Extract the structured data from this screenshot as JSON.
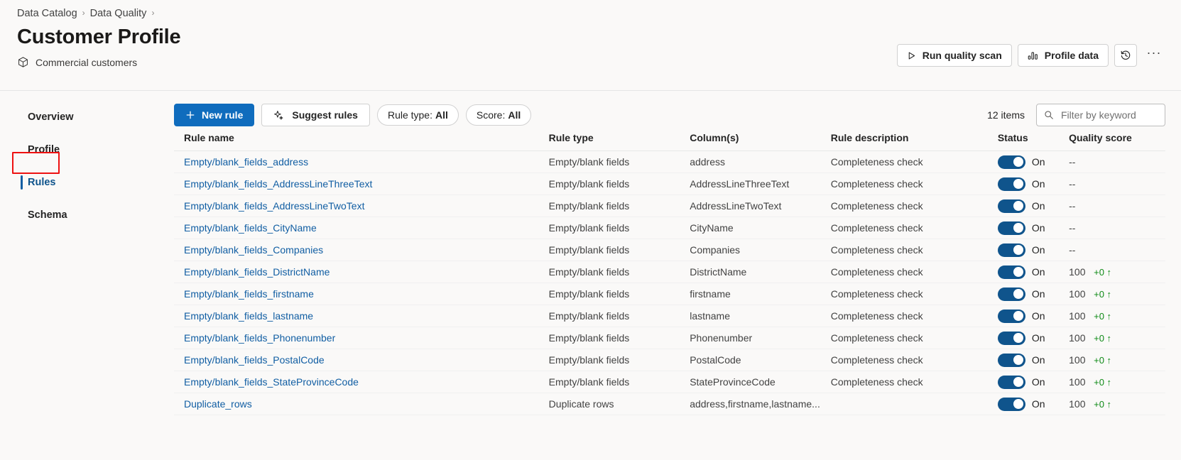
{
  "breadcrumb": {
    "items": [
      "Data Catalog",
      "Data Quality"
    ],
    "separator": "›"
  },
  "header": {
    "title": "Customer Profile",
    "subtitle": "Commercial customers",
    "subtitle_icon": "package-icon",
    "actions": [
      {
        "label": "Run quality scan",
        "icon": "play-icon"
      },
      {
        "label": "Profile data",
        "icon": "bar-chart-icon"
      },
      {
        "label": "",
        "icon": "history-icon"
      },
      {
        "label": "···",
        "icon": "more-options-icon"
      }
    ]
  },
  "sidebar": {
    "items": [
      {
        "label": "Overview",
        "selected": false
      },
      {
        "label": "Profile",
        "selected": false
      },
      {
        "label": "Rules",
        "selected": true
      },
      {
        "label": "Schema",
        "selected": false
      }
    ]
  },
  "toolbar": {
    "new_rule_label": "New rule",
    "new_rule_icon": "plus-icon",
    "suggest_rules_label": "Suggest rules",
    "suggest_rules_icon": "sparkle-icon",
    "filters": [
      {
        "label": "Rule type:",
        "value": "All"
      },
      {
        "label": "Score:",
        "value": "All"
      }
    ],
    "item_count": "12 items",
    "search_placeholder": "Filter by keyword",
    "search_value": "",
    "search_icon": "search-icon"
  },
  "table": {
    "columns": [
      "Rule name",
      "Rule type",
      "Column(s)",
      "Rule description",
      "Status",
      "Quality score"
    ],
    "rows": [
      {
        "name": "Empty/blank_fields_address",
        "type": "Empty/blank fields",
        "columns": "address",
        "description": "Completeness check",
        "status": "On",
        "status_on": true,
        "score": "--",
        "delta": ""
      },
      {
        "name": "Empty/blank_fields_AddressLineThreeText",
        "type": "Empty/blank fields",
        "columns": "AddressLineThreeText",
        "description": "Completeness check",
        "status": "On",
        "status_on": true,
        "score": "--",
        "delta": ""
      },
      {
        "name": "Empty/blank_fields_AddressLineTwoText",
        "type": "Empty/blank fields",
        "columns": "AddressLineTwoText",
        "description": "Completeness check",
        "status": "On",
        "status_on": true,
        "score": "--",
        "delta": ""
      },
      {
        "name": "Empty/blank_fields_CityName",
        "type": "Empty/blank fields",
        "columns": "CityName",
        "description": "Completeness check",
        "status": "On",
        "status_on": true,
        "score": "--",
        "delta": ""
      },
      {
        "name": "Empty/blank_fields_Companies",
        "type": "Empty/blank fields",
        "columns": "Companies",
        "description": "Completeness check",
        "status": "On",
        "status_on": true,
        "score": "--",
        "delta": ""
      },
      {
        "name": "Empty/blank_fields_DistrictName",
        "type": "Empty/blank fields",
        "columns": "DistrictName",
        "description": "Completeness check",
        "status": "On",
        "status_on": true,
        "score": "100",
        "delta": "+0 ↑"
      },
      {
        "name": "Empty/blank_fields_firstname",
        "type": "Empty/blank fields",
        "columns": "firstname",
        "description": "Completeness check",
        "status": "On",
        "status_on": true,
        "score": "100",
        "delta": "+0 ↑"
      },
      {
        "name": "Empty/blank_fields_lastname",
        "type": "Empty/blank fields",
        "columns": "lastname",
        "description": "Completeness check",
        "status": "On",
        "status_on": true,
        "score": "100",
        "delta": "+0 ↑"
      },
      {
        "name": "Empty/blank_fields_Phonenumber",
        "type": "Empty/blank fields",
        "columns": "Phonenumber",
        "description": "Completeness check",
        "status": "On",
        "status_on": true,
        "score": "100",
        "delta": "+0 ↑"
      },
      {
        "name": "Empty/blank_fields_PostalCode",
        "type": "Empty/blank fields",
        "columns": "PostalCode",
        "description": "Completeness check",
        "status": "On",
        "status_on": true,
        "score": "100",
        "delta": "+0 ↑"
      },
      {
        "name": "Empty/blank_fields_StateProvinceCode",
        "type": "Empty/blank fields",
        "columns": "StateProvinceCode",
        "description": "Completeness check",
        "status": "On",
        "status_on": true,
        "score": "100",
        "delta": "+0 ↑"
      },
      {
        "name": "Duplicate_rows",
        "type": "Duplicate rows",
        "columns": "address,firstname,lastname...",
        "description": "",
        "status": "On",
        "status_on": true,
        "score": "100",
        "delta": "+0 ↑"
      }
    ]
  },
  "colors": {
    "primary": "#0f6cbd",
    "link": "#115ea3",
    "toggle_on": "#0f548c",
    "delta_positive": "#0e8a16",
    "annotation": "#ee1111",
    "page_bg": "#faf9f8"
  }
}
